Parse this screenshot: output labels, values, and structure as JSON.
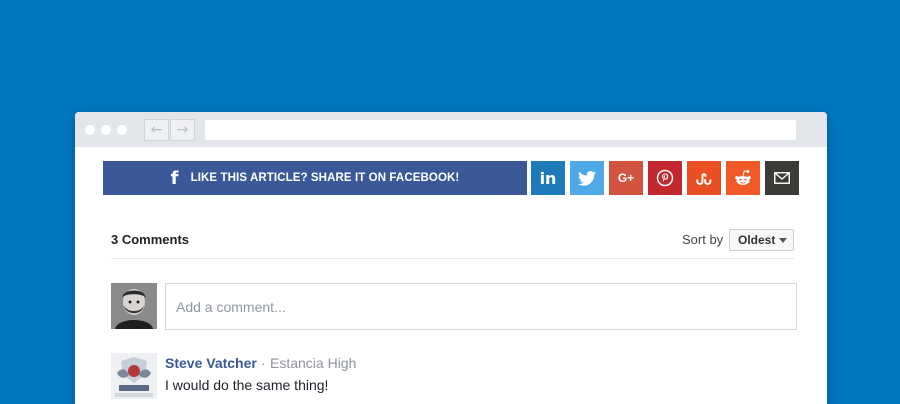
{
  "share": {
    "facebook_label": "LIKE THIS ARTICLE? SHARE IT ON FACEBOOK!",
    "facebook_color": "#3b5998",
    "buttons": [
      {
        "name": "linkedin",
        "glyph": "in",
        "color": "#1e7bb8"
      },
      {
        "name": "twitter",
        "glyph": "",
        "color": "#4fa9e6"
      },
      {
        "name": "google-plus",
        "glyph": "G+",
        "color": "#d2533e"
      },
      {
        "name": "pinterest",
        "glyph": "",
        "color": "#c4282f"
      },
      {
        "name": "stumbleupon",
        "glyph": "",
        "color": "#eb5025"
      },
      {
        "name": "reddit",
        "glyph": "",
        "color": "#f05a28"
      },
      {
        "name": "email",
        "glyph": "",
        "color": "#3d3b38"
      }
    ]
  },
  "comments": {
    "count_label": "3 Comments",
    "sort_label": "Sort by",
    "sort_value": "Oldest",
    "input_placeholder": "Add a comment...",
    "items": [
      {
        "author": "Steve Vatcher",
        "separator": "·",
        "affiliation": "Estancia High",
        "text": "I would do the same thing!"
      }
    ]
  },
  "colors": {
    "background": "#0077c2",
    "link": "#3b5998"
  }
}
